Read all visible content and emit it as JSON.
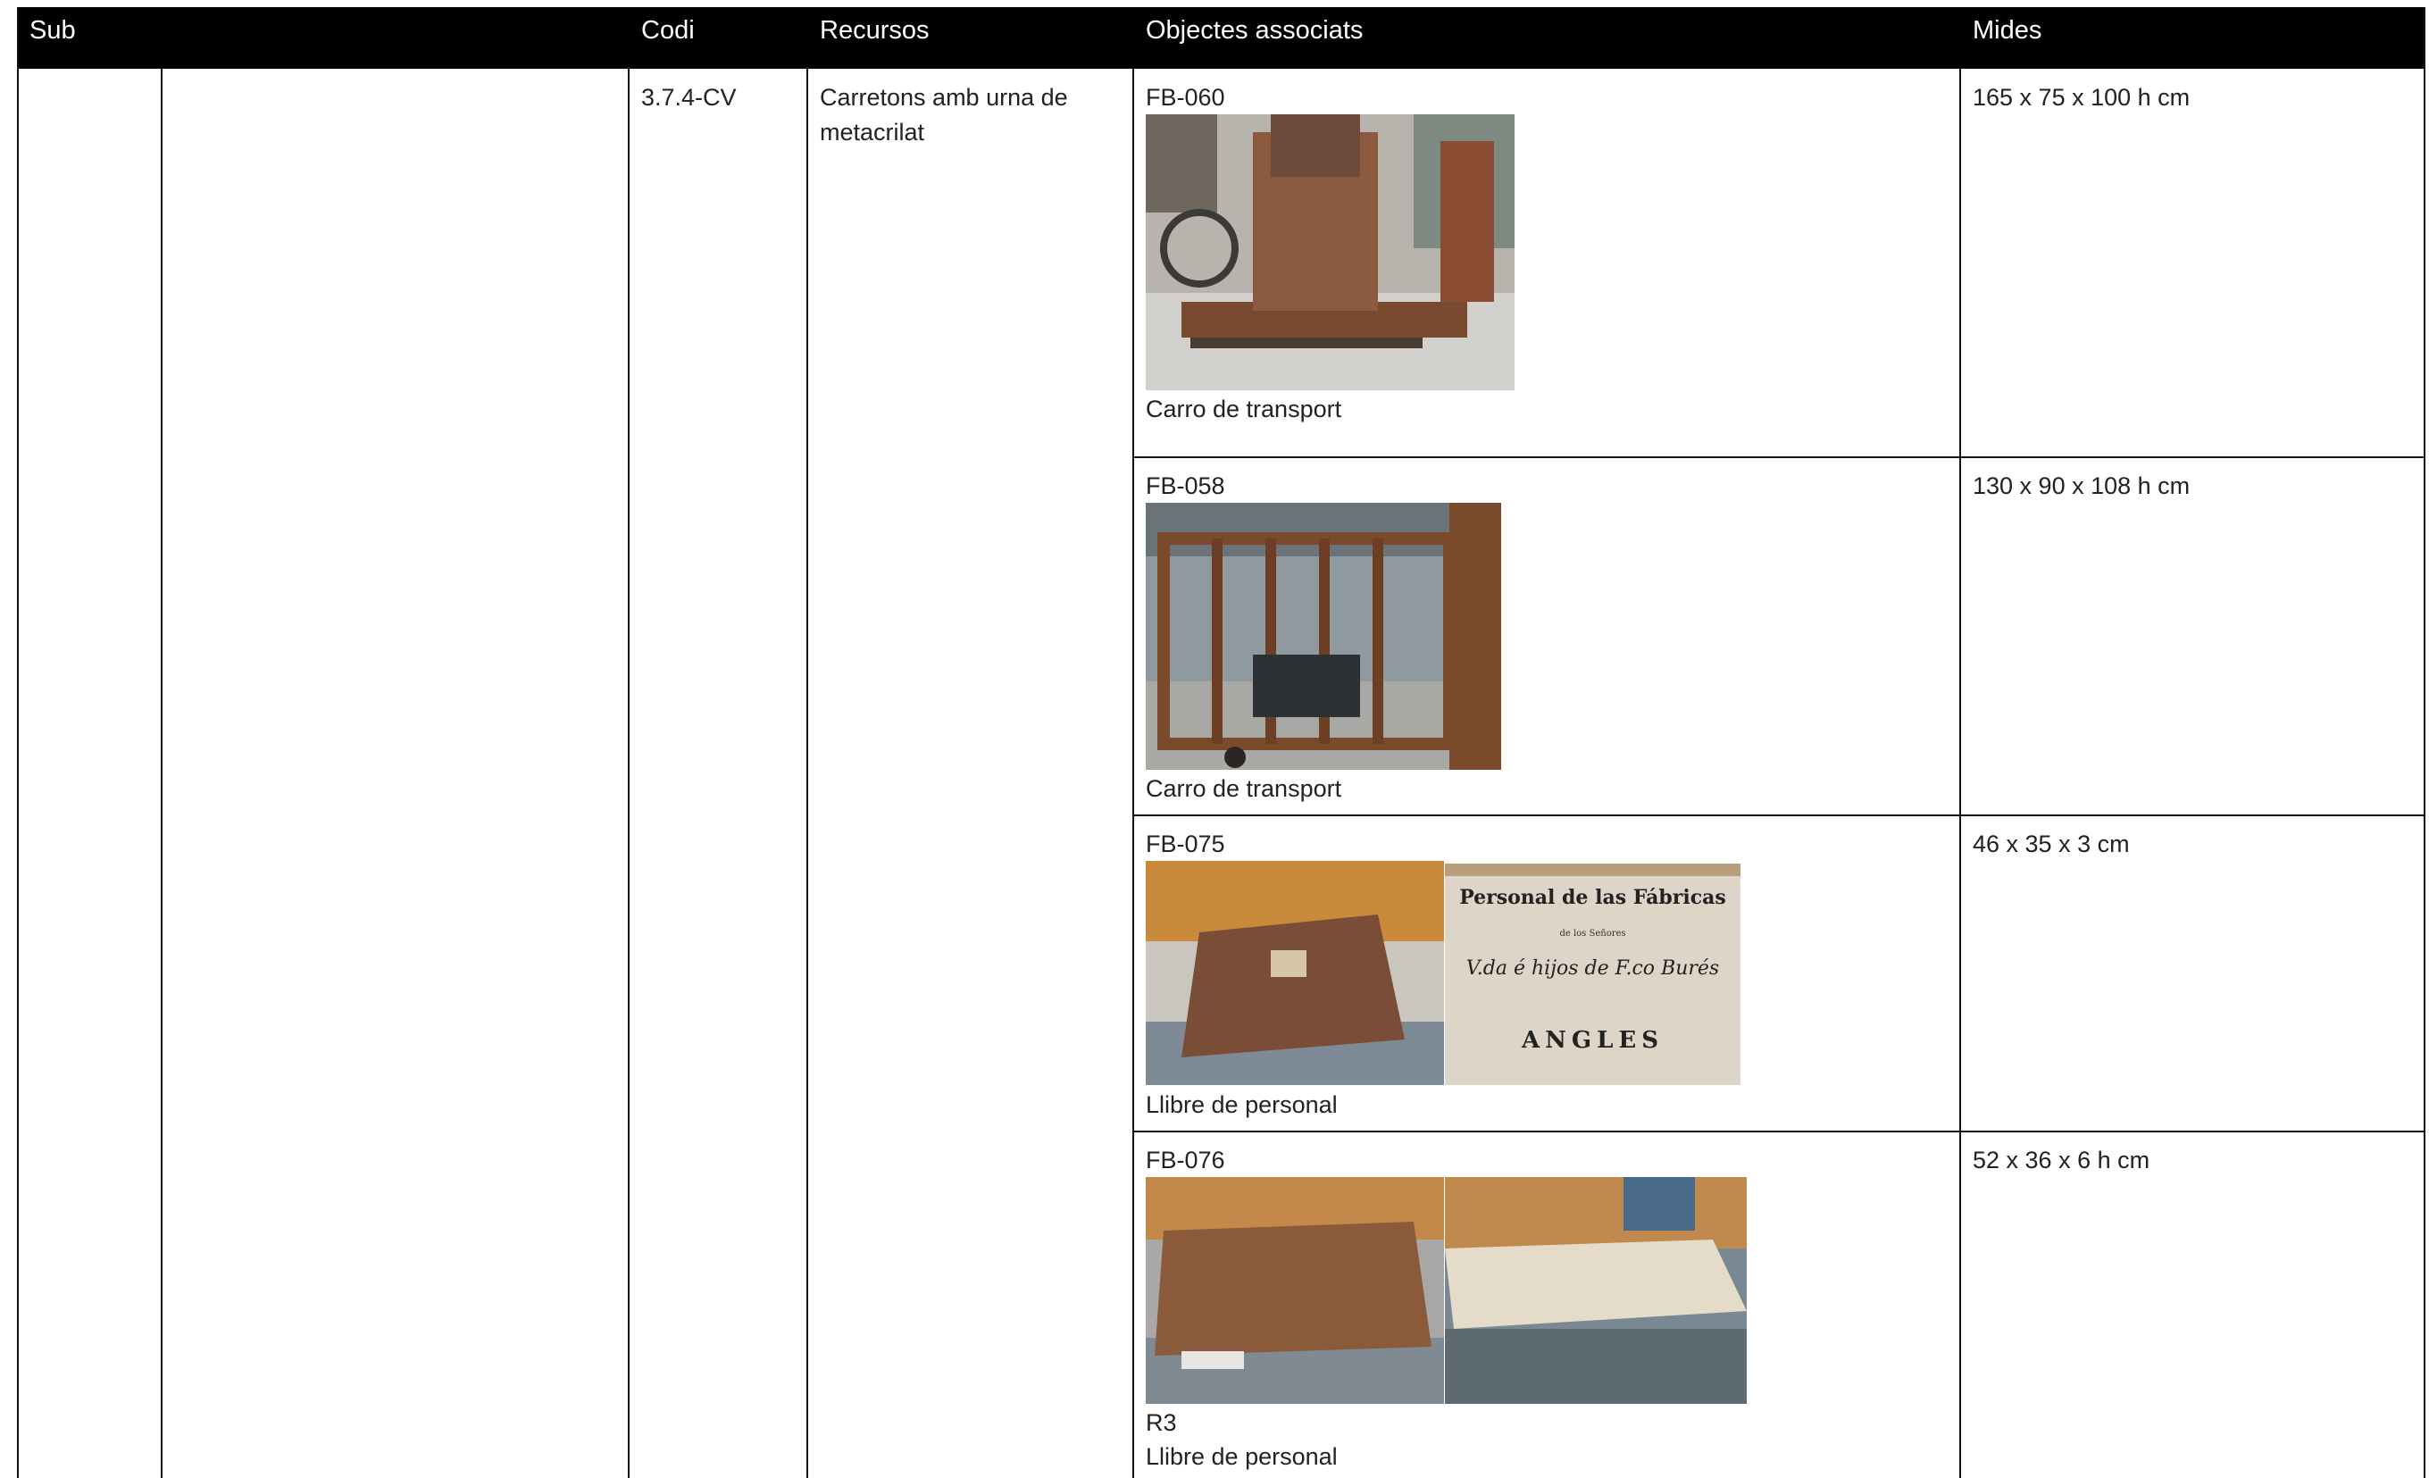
{
  "header": {
    "sub": "Sub",
    "codi": "Codi",
    "recursos": "Recursos",
    "objectes": "Objectes associats",
    "mides": "Mides"
  },
  "resource": {
    "codi": "3.7.4-CV",
    "recursos": "Carretons amb urna de metacrilat"
  },
  "items": [
    {
      "code": "FB-060",
      "caption": "Carro de transport",
      "mides": "165 x 75 x 100 h cm"
    },
    {
      "code": "FB-058",
      "caption": "Carro de transport",
      "mides": "130 x 90 x 108 h cm"
    },
    {
      "code": "FB-075",
      "caption": "Llibre de personal",
      "mides": "46 x 35 x 3 cm",
      "photo_text": {
        "line1": "Personal de las Fábricas",
        "line2": "de los Señores",
        "line3": "V.da é hijos de F.co Burés",
        "line4": "ANGLES"
      }
    },
    {
      "code": "FB-076",
      "extra": "R3",
      "caption": "Llibre de personal",
      "mides": "52 x 36 x 6 h cm"
    }
  ]
}
